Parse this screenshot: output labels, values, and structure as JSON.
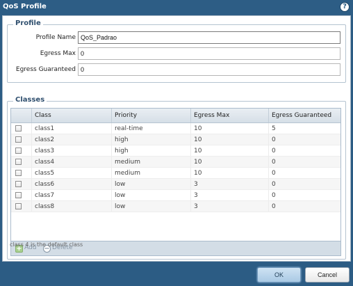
{
  "dialog": {
    "title": "QoS Profile"
  },
  "profile": {
    "legend": "Profile",
    "fields": [
      {
        "label": "Profile Name",
        "value": "QoS_Padrao"
      },
      {
        "label": "Egress Max",
        "value": "0"
      },
      {
        "label": "Egress Guaranteed",
        "value": "0"
      }
    ]
  },
  "classes": {
    "legend": "Classes",
    "columns": [
      "Class",
      "Priority",
      "Egress Max",
      "Egress Guaranteed"
    ],
    "rows": [
      [
        "class1",
        "real-time",
        "10",
        "5"
      ],
      [
        "class2",
        "high",
        "10",
        "0"
      ],
      [
        "class3",
        "high",
        "10",
        "0"
      ],
      [
        "class4",
        "medium",
        "10",
        "0"
      ],
      [
        "class5",
        "medium",
        "10",
        "0"
      ],
      [
        "class6",
        "low",
        "3",
        "0"
      ],
      [
        "class7",
        "low",
        "3",
        "0"
      ],
      [
        "class8",
        "low",
        "3",
        "0"
      ]
    ],
    "toolbar": {
      "add_label": "Add",
      "delete_label": "Delete"
    },
    "note": "class 4 is the default class"
  },
  "footer": {
    "ok_label": "OK",
    "cancel_label": "Cancel"
  }
}
